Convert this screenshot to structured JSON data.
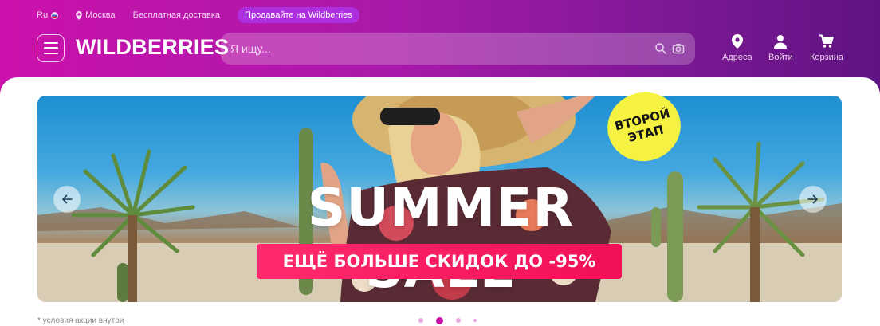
{
  "topbar": {
    "language": "Ru",
    "city": "Москва",
    "delivery": "Бесплатная доставка",
    "sell": "Продавайте на Wildberries"
  },
  "header": {
    "logo": "WILDBERRIES",
    "search_placeholder": "Я ищу...",
    "nav": {
      "addresses": "Адреса",
      "login": "Войти",
      "cart": "Корзина"
    }
  },
  "banner": {
    "sticker_line1": "ВТОРОЙ",
    "sticker_line2": "ЭТАП",
    "title": "SUMMER SALE",
    "subtitle": "ЕЩЁ БОЛЬШЕ СКИДОК ДО -95%",
    "footnote": "* условия акции внутри",
    "slides_visible": 4,
    "active_slide": 2
  },
  "colors": {
    "brand": "#cb11ab",
    "brand_dark": "#5f1382",
    "sale_pink": "#f21058",
    "sticker_yellow": "#f5f242"
  },
  "icons": [
    "burger-icon",
    "location-icon",
    "search-icon",
    "camera-icon",
    "user-icon",
    "cart-icon",
    "arrow-left-icon",
    "arrow-right-icon"
  ]
}
